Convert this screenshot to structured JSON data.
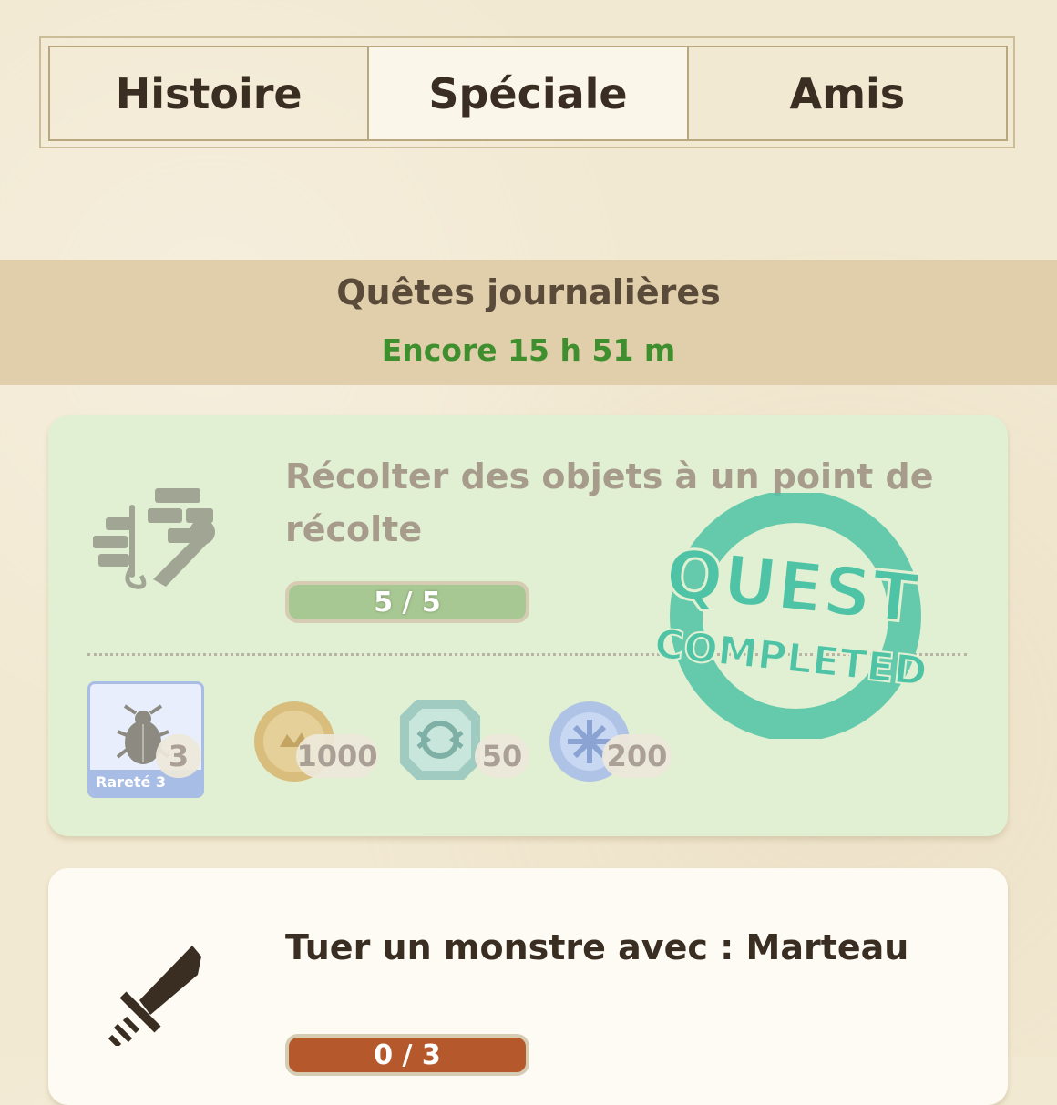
{
  "tabs": [
    {
      "label": "Histoire",
      "active": false
    },
    {
      "label": "Spéciale",
      "active": true
    },
    {
      "label": "Amis",
      "active": false
    }
  ],
  "daily": {
    "title": "Quêtes journalières",
    "remaining": "Encore 15 h 51 m"
  },
  "quests": [
    {
      "icon": "gathering-point-icon",
      "title": "Récolter des objets à un point de récolte",
      "progress_text": "5 / 5",
      "progress_fraction": 1.0,
      "completed": true,
      "stamp_line1": "QUEST",
      "stamp_line2": "COMPLETED",
      "rewards": {
        "item": {
          "icon": "beetle-icon",
          "quantity": "3",
          "rarity": "Rareté 3"
        },
        "zenny": {
          "icon": "zenny-coin-icon",
          "quantity": "1000"
        },
        "gem": {
          "icon": "emblem-gem-icon",
          "quantity": "50"
        },
        "orb": {
          "icon": "blue-orb-icon",
          "quantity": "200"
        }
      }
    },
    {
      "icon": "great-sword-icon",
      "title": "Tuer un monstre avec : Marteau",
      "progress_text": "0 / 3",
      "progress_fraction": 0.0,
      "completed": false
    }
  ],
  "colors": {
    "background": "#f2e9d2",
    "band": "#e0cfaa",
    "timer_green": "#3f8f2f",
    "completed_card": "#e1f0d2",
    "stamp_teal": "#4fc3a6",
    "progress_orange": "#b5582c"
  }
}
